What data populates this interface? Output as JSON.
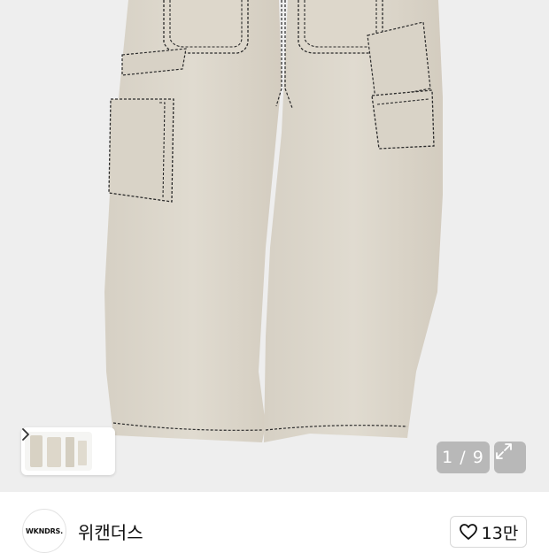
{
  "gallery": {
    "image_counter": "1 / 9",
    "thumbnail_logo_text": "WKNDRS."
  },
  "brand": {
    "logo_text": "WKNDRS.",
    "name": "위캔더스"
  },
  "like": {
    "count": "13만"
  },
  "icons": {
    "thumbnail_next": "chevron-right-icon",
    "expand": "expand-icon",
    "like": "heart-outline-icon"
  },
  "colors": {
    "hero_background": "#eeeeee",
    "pants_fabric": "#dcd6ca",
    "stitching": "#2a2a2a",
    "overlay_button": "rgba(140,140,140,0.55)"
  }
}
